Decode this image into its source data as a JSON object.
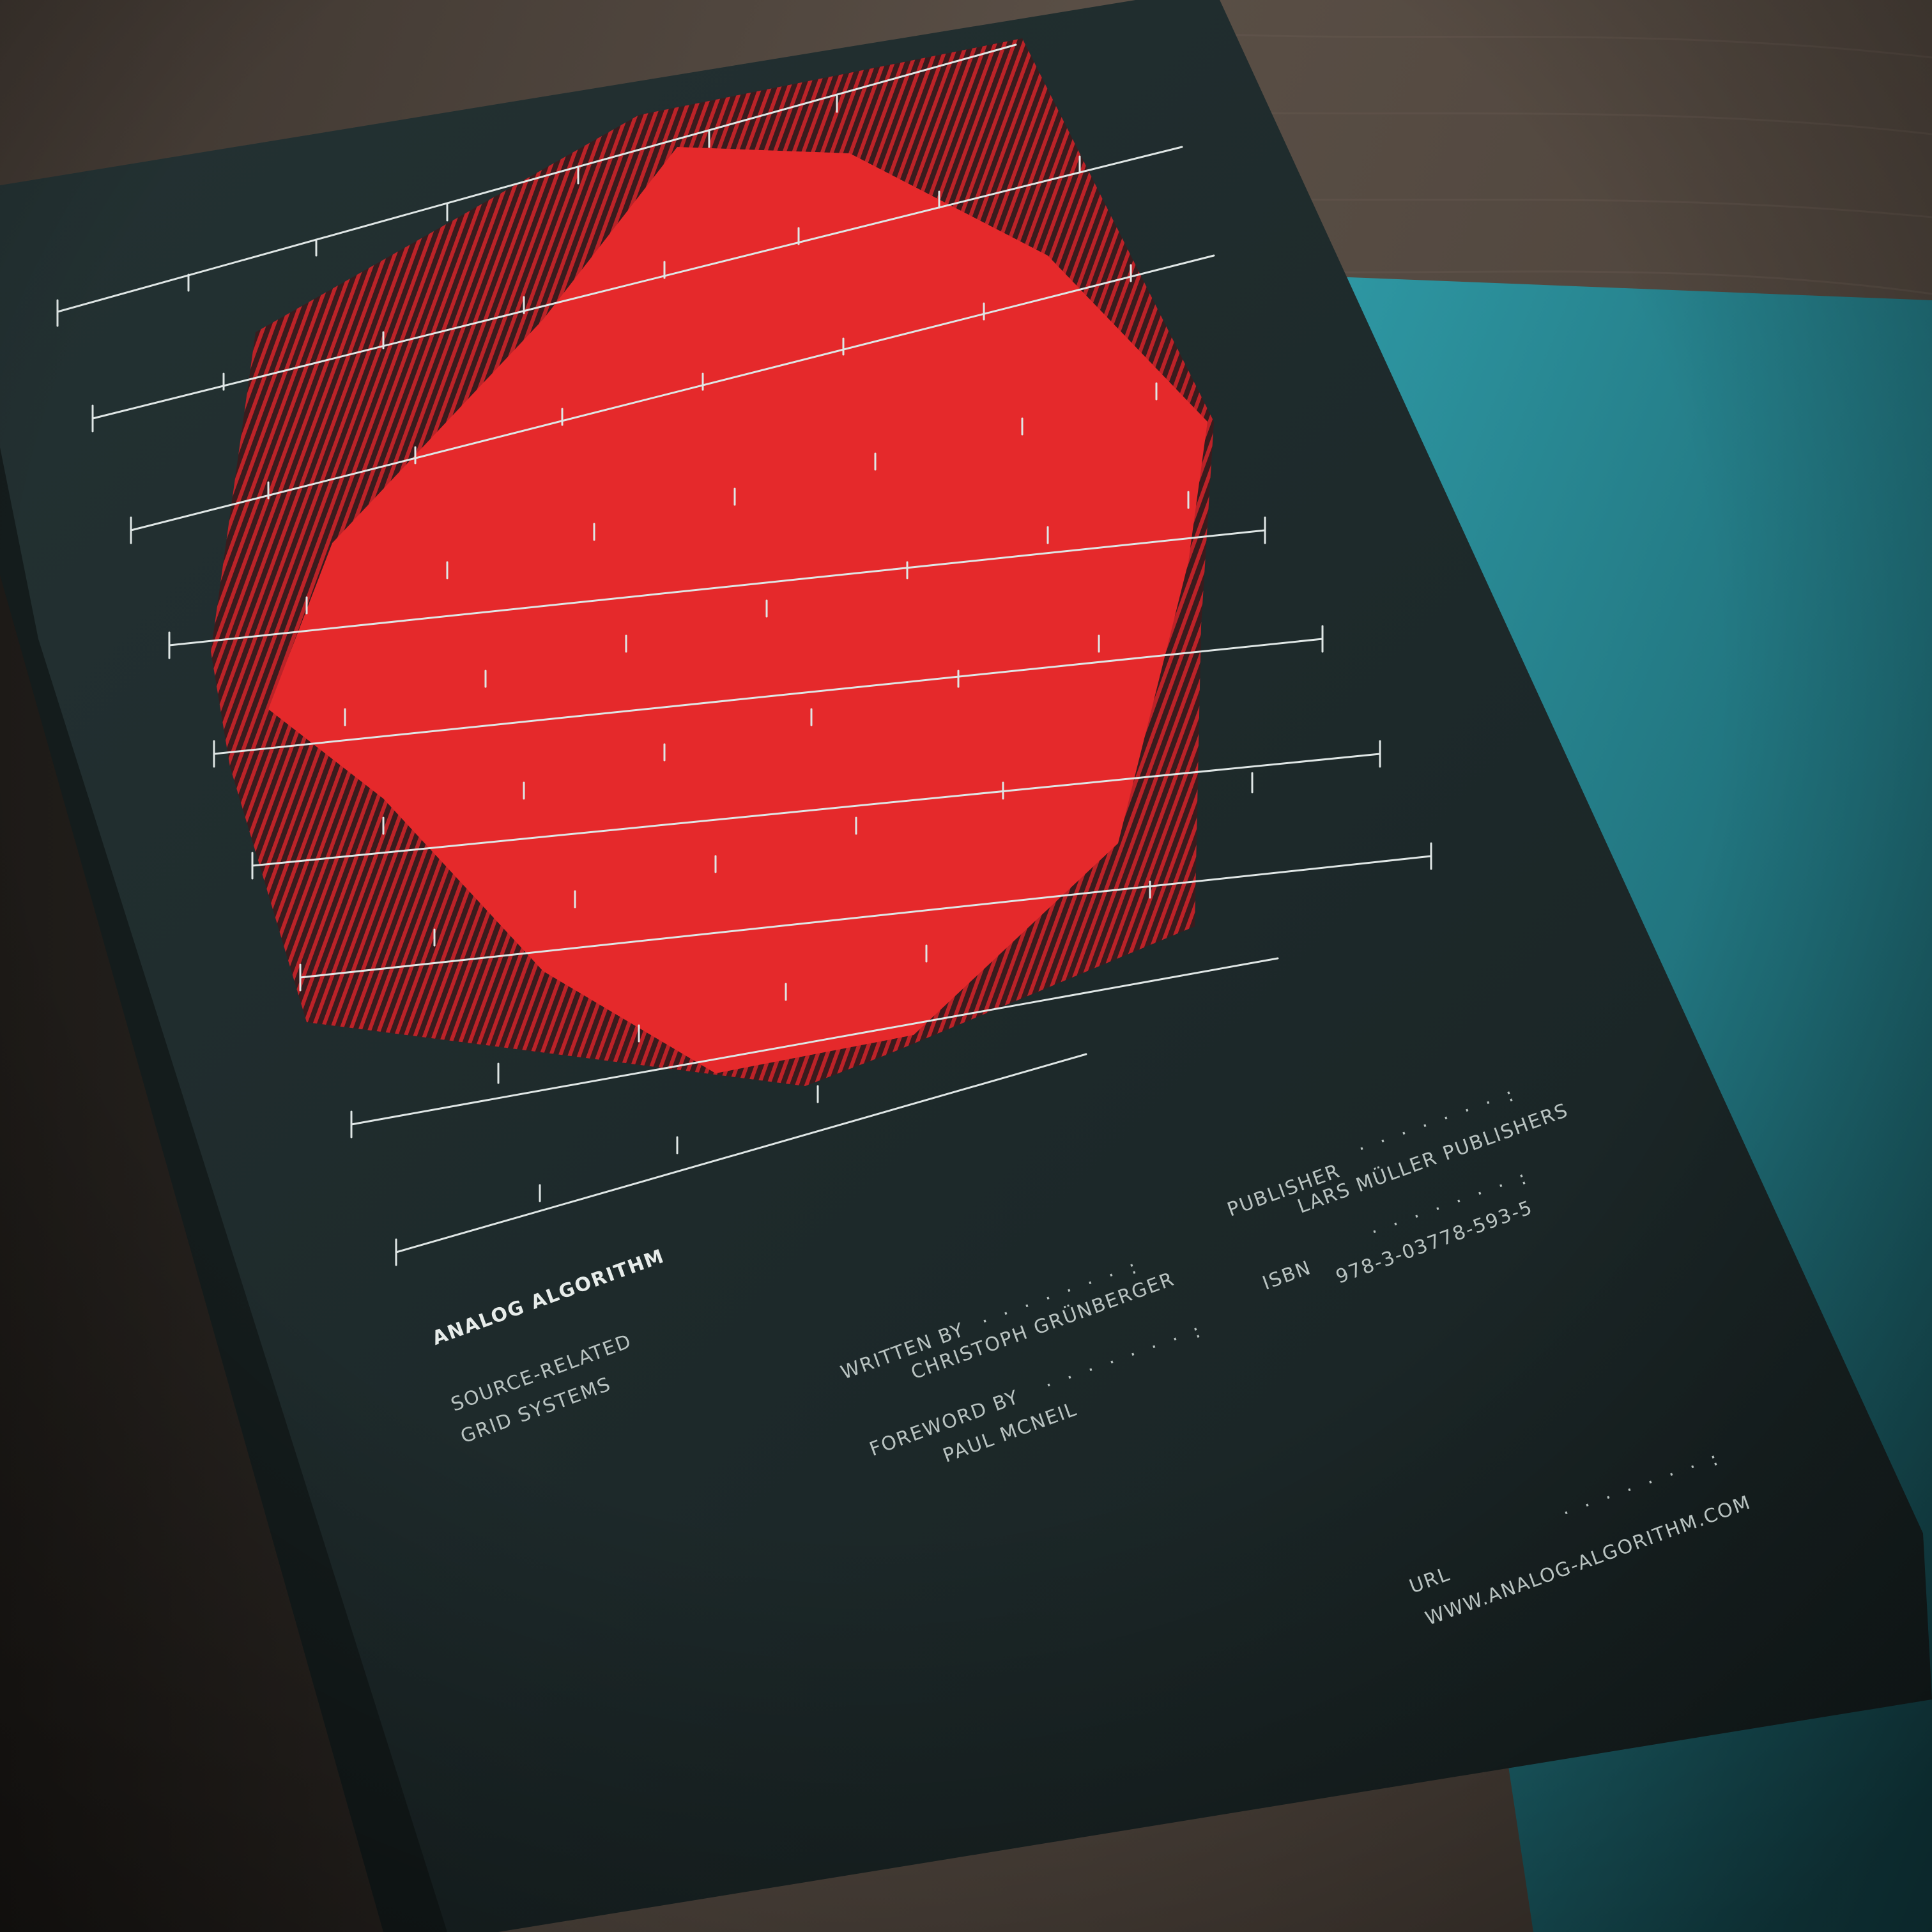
{
  "book": {
    "title": "ANALOG ALGORITHM",
    "subtitle_line1": "SOURCE-RELATED",
    "subtitle_line2": "GRID SYSTEMS",
    "written_by_label": "WRITTEN BY",
    "author": "CHRISTOPH GRÜNBERGER",
    "foreword_label": "FOREWORD BY",
    "foreword_author": "PAUL MCNEIL",
    "publisher_label": "PUBLISHER",
    "publisher": "LARS MÜLLER PUBLISHERS",
    "isbn_label": "ISBN",
    "isbn": "978-3-03778-593-5",
    "url_label": "URL",
    "url": "WWW.ANALOG-ALGORITHM.COM",
    "leader_dots": "· · · · · · · :"
  },
  "colors": {
    "table_wood": "#4a3f37",
    "cover": "#1f2c2d",
    "red_shape": "#e5292b",
    "hatch": "#b0202a",
    "grid_lines": "#dfe6e5",
    "teal_paper": "#2d8a96"
  }
}
